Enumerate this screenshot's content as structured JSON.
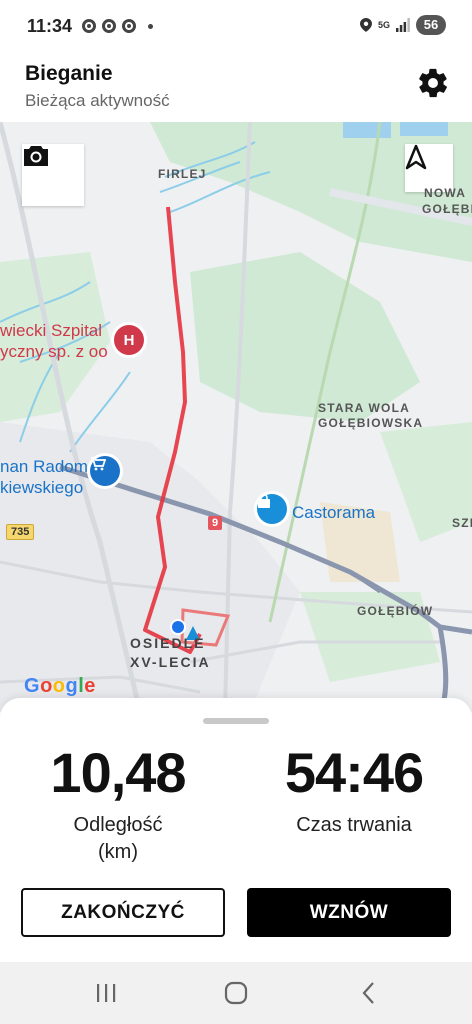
{
  "status_bar": {
    "time": "11:34",
    "network": "5G",
    "battery": "56"
  },
  "header": {
    "title": "Bieganie",
    "subtitle": "Bieżąca aktywność"
  },
  "map": {
    "labels": {
      "firlej": "FIRLEJ",
      "nowa_line1": "NOWA",
      "nowa_line2": "GOŁĘBI",
      "stara_wola_line1": "STARA WOLA",
      "stara_wola_line2": "GOŁĘBIOWSKA",
      "golebiow": "GOŁĘBIÓW",
      "szl": "SZL",
      "osiedle_line1": "OSIEDLE",
      "osiedle_line2": "XV-LECIA"
    },
    "pois": {
      "hospital_line1": "wiecki Szpital",
      "hospital_line2": "yczny sp. z oo",
      "radom_line1": "nan Radom",
      "radom_line2": "kiewskiego",
      "castorama": "Castorama"
    },
    "road_badges": {
      "r9": "9",
      "r735": "735"
    },
    "attribution": "Google",
    "colors": {
      "route": "#e5333f",
      "road_major": "#8a96ad",
      "park": "#c9e8cf",
      "water": "#9fd0ee"
    }
  },
  "stats": {
    "distance_value": "10,48",
    "distance_label_line1": "Odległość",
    "distance_label_line2": "(km)",
    "duration_value": "54:46",
    "duration_label": "Czas trwania"
  },
  "buttons": {
    "end": "ZAKOŃCZYĆ",
    "resume": "WZNÓW"
  }
}
